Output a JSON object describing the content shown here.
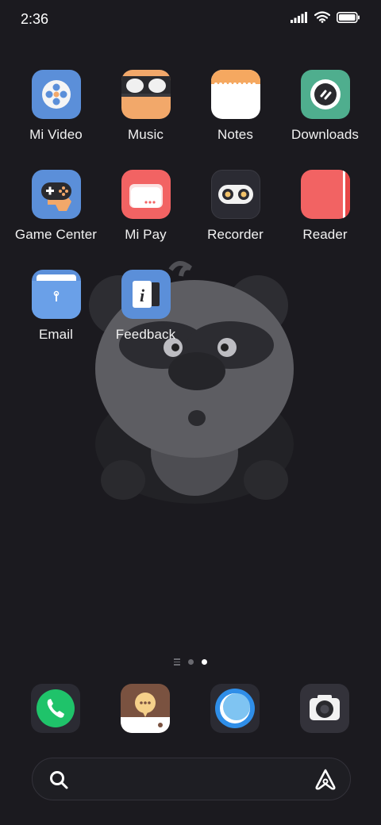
{
  "status_bar": {
    "time": "2:36",
    "icons": [
      "signal-icon",
      "wifi-icon",
      "battery-icon"
    ]
  },
  "apps": [
    {
      "label": "Mi Video",
      "icon": "mi-video-icon"
    },
    {
      "label": "Music",
      "icon": "music-icon"
    },
    {
      "label": "Notes",
      "icon": "notes-icon"
    },
    {
      "label": "Downloads",
      "icon": "downloads-icon"
    },
    {
      "label": "Game Center",
      "icon": "game-center-icon"
    },
    {
      "label": "Mi Pay",
      "icon": "mi-pay-icon"
    },
    {
      "label": "Recorder",
      "icon": "recorder-icon"
    },
    {
      "label": "Reader",
      "icon": "reader-icon"
    },
    {
      "label": "Email",
      "icon": "email-icon"
    },
    {
      "label": "Feedback",
      "icon": "feedback-icon"
    }
  ],
  "page_indicator": {
    "pages": 2,
    "active_index": 1
  },
  "dock": [
    {
      "icon": "phone-icon"
    },
    {
      "icon": "messages-icon"
    },
    {
      "icon": "browser-icon"
    },
    {
      "icon": "camera-icon"
    }
  ],
  "search_bar": {
    "icons": [
      "search-icon",
      "assistant-icon"
    ]
  },
  "colors": {
    "background": "#1b1a1f",
    "mi_video": "#5b8fd9",
    "music": "#f2a86a",
    "notes_top": "#f5a860",
    "downloads": "#4fae8e",
    "game_center": "#5b8fd9",
    "mi_pay": "#f26363",
    "recorder": "#2b2b33",
    "reader": "#f26363",
    "email": "#5b8fd9",
    "feedback": "#5b8fd9",
    "phone": "#1fc36a",
    "messages": "#7a5240",
    "browser": "#2f8ee8"
  }
}
